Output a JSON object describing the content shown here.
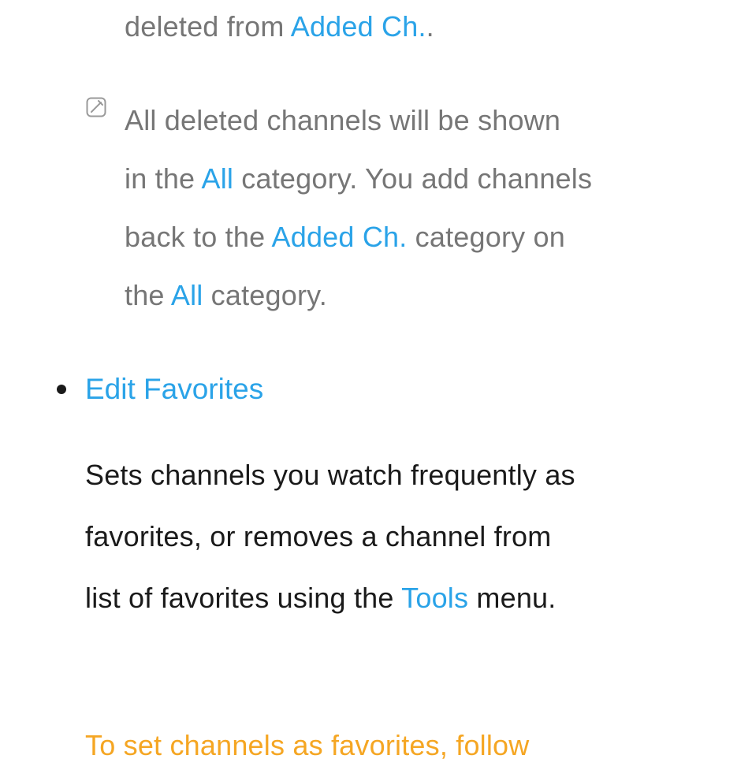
{
  "line1": {
    "t1": "deleted from ",
    "link": "Added Ch.",
    "t2": "."
  },
  "note": {
    "l1_a": "All deleted channels will be shown",
    "l2_a": "in the ",
    "l2_b": "All",
    "l2_c": " category. You add channels",
    "l3_a": "back to the ",
    "l3_b": "Added Ch.",
    "l3_c": " category on",
    "l4_a": "the ",
    "l4_b": "All",
    "l4_c": " category."
  },
  "section": {
    "title": "Edit Favorites"
  },
  "body": {
    "l1": "Sets channels you watch frequently as",
    "l2": "favorites, or removes a channel from",
    "l3_a": "list of favorites using the ",
    "l3_b": "Tools",
    "l3_c": " menu."
  },
  "footer": {
    "l1": "To set channels as favorites, follow"
  }
}
